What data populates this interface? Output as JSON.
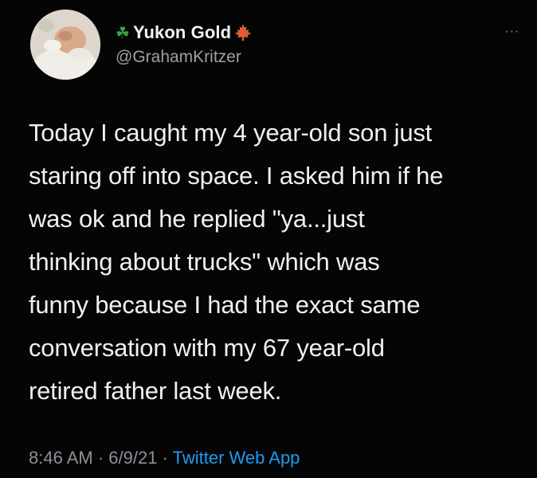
{
  "user": {
    "display_name": "Yukon Gold",
    "handle": "@GrahamKritzer",
    "avatar_icon": "baby-photo-avatar",
    "name_prefix_emoji": "four-leaf-clover-icon",
    "name_suffix_emoji": "maple-leaf-icon"
  },
  "tweet": {
    "lines": [
      "Today I caught my 4 year-old son just",
      "staring off into space. I asked him if he",
      "was ok and he replied \"ya...just",
      "thinking about trucks\" which was",
      "funny because I had the exact same",
      "conversation with my 67 year-old",
      "retired father last week."
    ],
    "time": "8:46 AM",
    "date": "6/9/21",
    "separator": "·",
    "source": "Twitter Web App"
  },
  "more_menu": "···",
  "colors": {
    "background": "#050505",
    "text": "#f0f0f0",
    "secondary": "#8b9299",
    "link": "#1d9bf0",
    "clover": "#3aa34b",
    "maple": "#e8553a"
  }
}
